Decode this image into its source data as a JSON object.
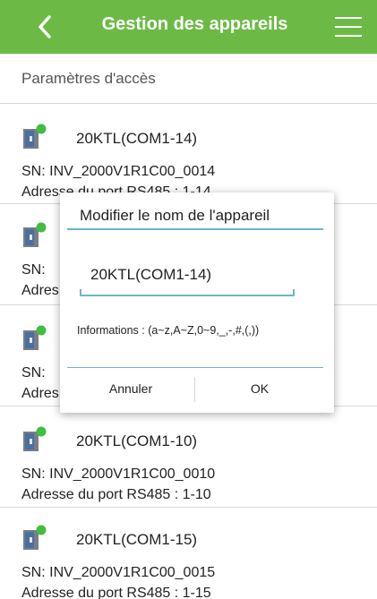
{
  "appbar": {
    "title": "Gestion des appareils",
    "back_icon": "chevron-left-icon",
    "menu_icon": "hamburger-menu-icon",
    "color": "#6cba45"
  },
  "section": {
    "header": "Paramètres d'accès"
  },
  "devices": [
    {
      "name": "20KTL(COM1-14)",
      "sn": "SN:  INV_2000V1R1C00_0014",
      "port": "Adresse du port RS485 : 1-14"
    },
    {
      "name": "",
      "sn": "SN:",
      "port": "Adres"
    },
    {
      "name": "",
      "sn": "SN:",
      "port": "Adres"
    },
    {
      "name": "20KTL(COM1-10)",
      "sn": "SN:  INV_2000V1R1C00_0010",
      "port": "Adresse du port RS485 : 1-10"
    },
    {
      "name": "20KTL(COM1-15)",
      "sn": "SN:  INV_2000V1R1C00_0015",
      "port": "Adresse du port RS485 : 1-15"
    }
  ],
  "device_icon": {
    "name": "inverter-icon",
    "status_color": "#3fbf3f"
  },
  "dialog": {
    "title": "Modifier le nom de l'appareil",
    "input_value": "20KTL(COM1-14)",
    "info": "Informations :   (a~z,A~Z,0~9,_,-,#,(,))",
    "cancel_label": "Annuler",
    "ok_label": "OK",
    "accent": "#6fb3c8"
  }
}
